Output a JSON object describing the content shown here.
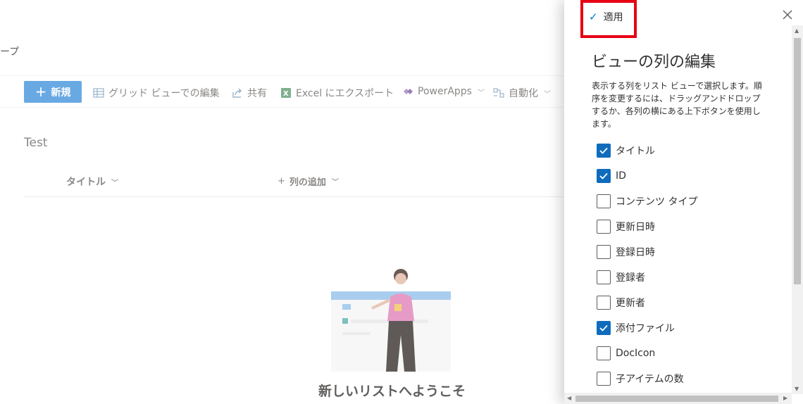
{
  "background": {
    "breadcrumb_fragment": "ープ",
    "command_bar": {
      "new_label": "新規",
      "grid_edit_label": "グリッド ビューでの編集",
      "share_label": "共有",
      "excel_export_label": "Excel にエクスポート",
      "powerapps_label": "PowerApps",
      "automate_label": "自動化"
    },
    "list_title": "Test",
    "columns": {
      "title_label": "タイトル",
      "add_column_label": "列の追加"
    },
    "welcome_text": "新しいリストへようこそ"
  },
  "panel": {
    "apply_label": "適用",
    "title": "ビューの列の編集",
    "description": "表示する列をリスト ビューで選択します。順序を変更するには、ドラッグアンドドロップするか、各列の横にある上下ボタンを使用します。",
    "columns": [
      {
        "label": "タイトル",
        "checked": true
      },
      {
        "label": "ID",
        "checked": true
      },
      {
        "label": "コンテンツ タイプ",
        "checked": false
      },
      {
        "label": "更新日時",
        "checked": false
      },
      {
        "label": "登録日時",
        "checked": false
      },
      {
        "label": "登録者",
        "checked": false
      },
      {
        "label": "更新者",
        "checked": false
      },
      {
        "label": "添付ファイル",
        "checked": true
      },
      {
        "label": "DocIcon",
        "checked": false
      },
      {
        "label": "子アイテムの数",
        "checked": false
      }
    ]
  },
  "colors": {
    "accent": "#0f6cbd",
    "new_button": "#69a9e3",
    "highlight_box": "#e60012"
  }
}
